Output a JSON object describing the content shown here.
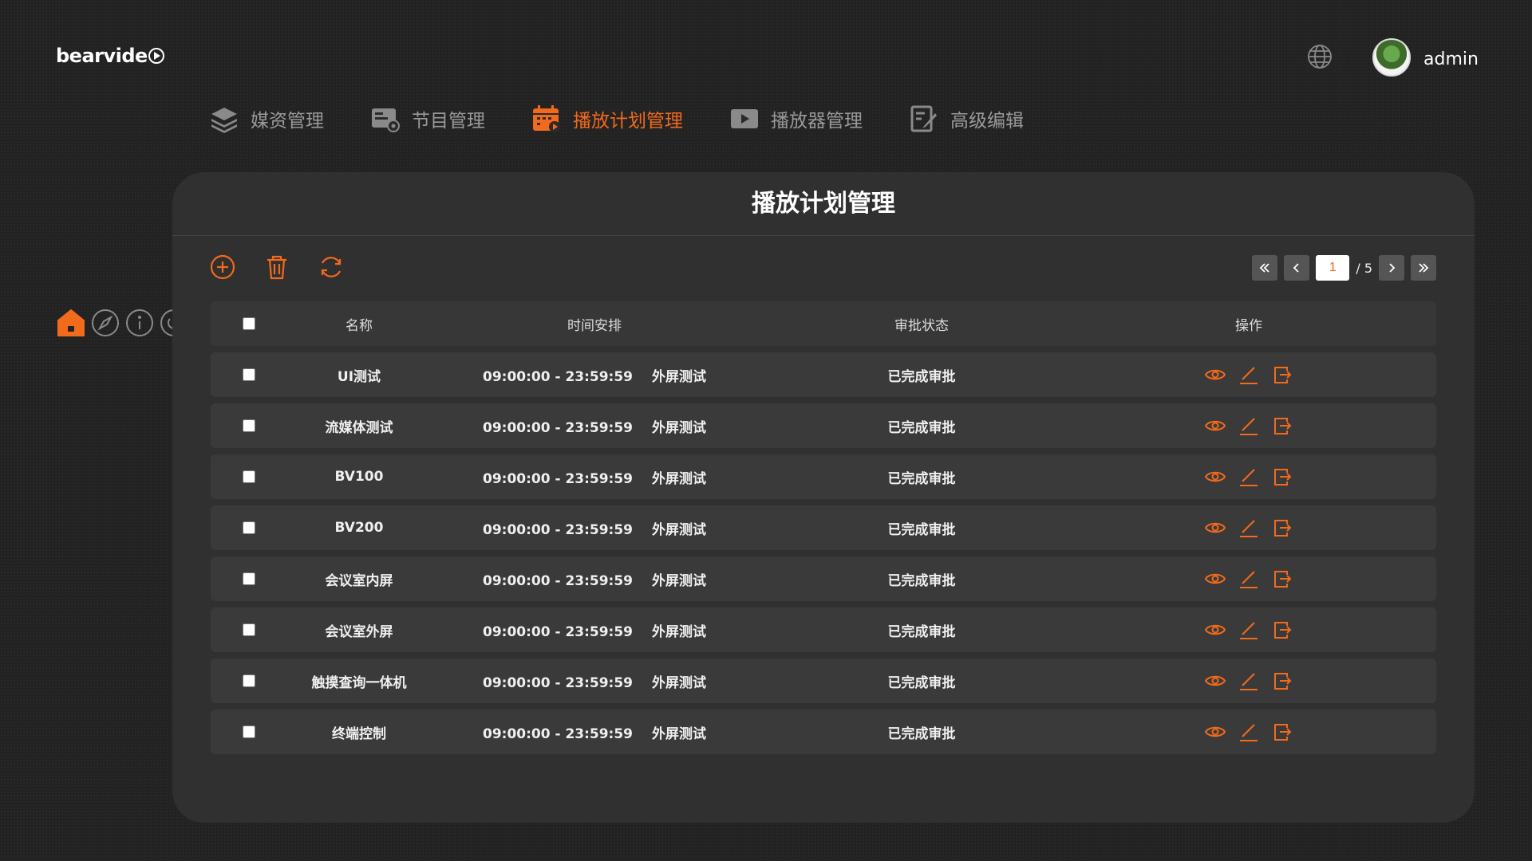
{
  "brand": {
    "logo_text": "bearvide",
    "accent": "#f26a1b"
  },
  "header": {
    "username": "admin"
  },
  "nav": [
    {
      "label": "媒资管理",
      "icon": "layers-icon",
      "active": false
    },
    {
      "label": "节目管理",
      "icon": "program-icon",
      "active": false
    },
    {
      "label": "播放计划管理",
      "icon": "calendar-play-icon",
      "active": true
    },
    {
      "label": "播放器管理",
      "icon": "player-icon",
      "active": false
    },
    {
      "label": "高级编辑",
      "icon": "edit-doc-icon",
      "active": false
    }
  ],
  "sidebar": [
    "home-icon",
    "compass-icon",
    "info-icon",
    "power-icon"
  ],
  "panel": {
    "title": "播放计划管理"
  },
  "pager": {
    "current": "1",
    "total": "/ 5"
  },
  "table": {
    "columns": {
      "name": "名称",
      "time": "时间安排",
      "status": "审批状态",
      "ops": "操作"
    },
    "rows": [
      {
        "name": "UI测试",
        "time": "09:00:00 - 23:59:59",
        "screen": "外屏测试",
        "status": "已完成审批"
      },
      {
        "name": "流媒体测试",
        "time": "09:00:00 - 23:59:59",
        "screen": "外屏测试",
        "status": "已完成审批"
      },
      {
        "name": "BV100",
        "time": "09:00:00 - 23:59:59",
        "screen": "外屏测试",
        "status": "已完成审批"
      },
      {
        "name": "BV200",
        "time": "09:00:00 - 23:59:59",
        "screen": "外屏测试",
        "status": "已完成审批"
      },
      {
        "name": "会议室内屏",
        "time": "09:00:00 - 23:59:59",
        "screen": "外屏测试",
        "status": "已完成审批"
      },
      {
        "name": "会议室外屏",
        "time": "09:00:00 - 23:59:59",
        "screen": "外屏测试",
        "status": "已完成审批"
      },
      {
        "name": "触摸查询一体机",
        "time": "09:00:00 - 23:59:59",
        "screen": "外屏测试",
        "status": "已完成审批"
      },
      {
        "name": "终端控制",
        "time": "09:00:00 - 23:59:59",
        "screen": "外屏测试",
        "status": "已完成审批"
      }
    ]
  }
}
